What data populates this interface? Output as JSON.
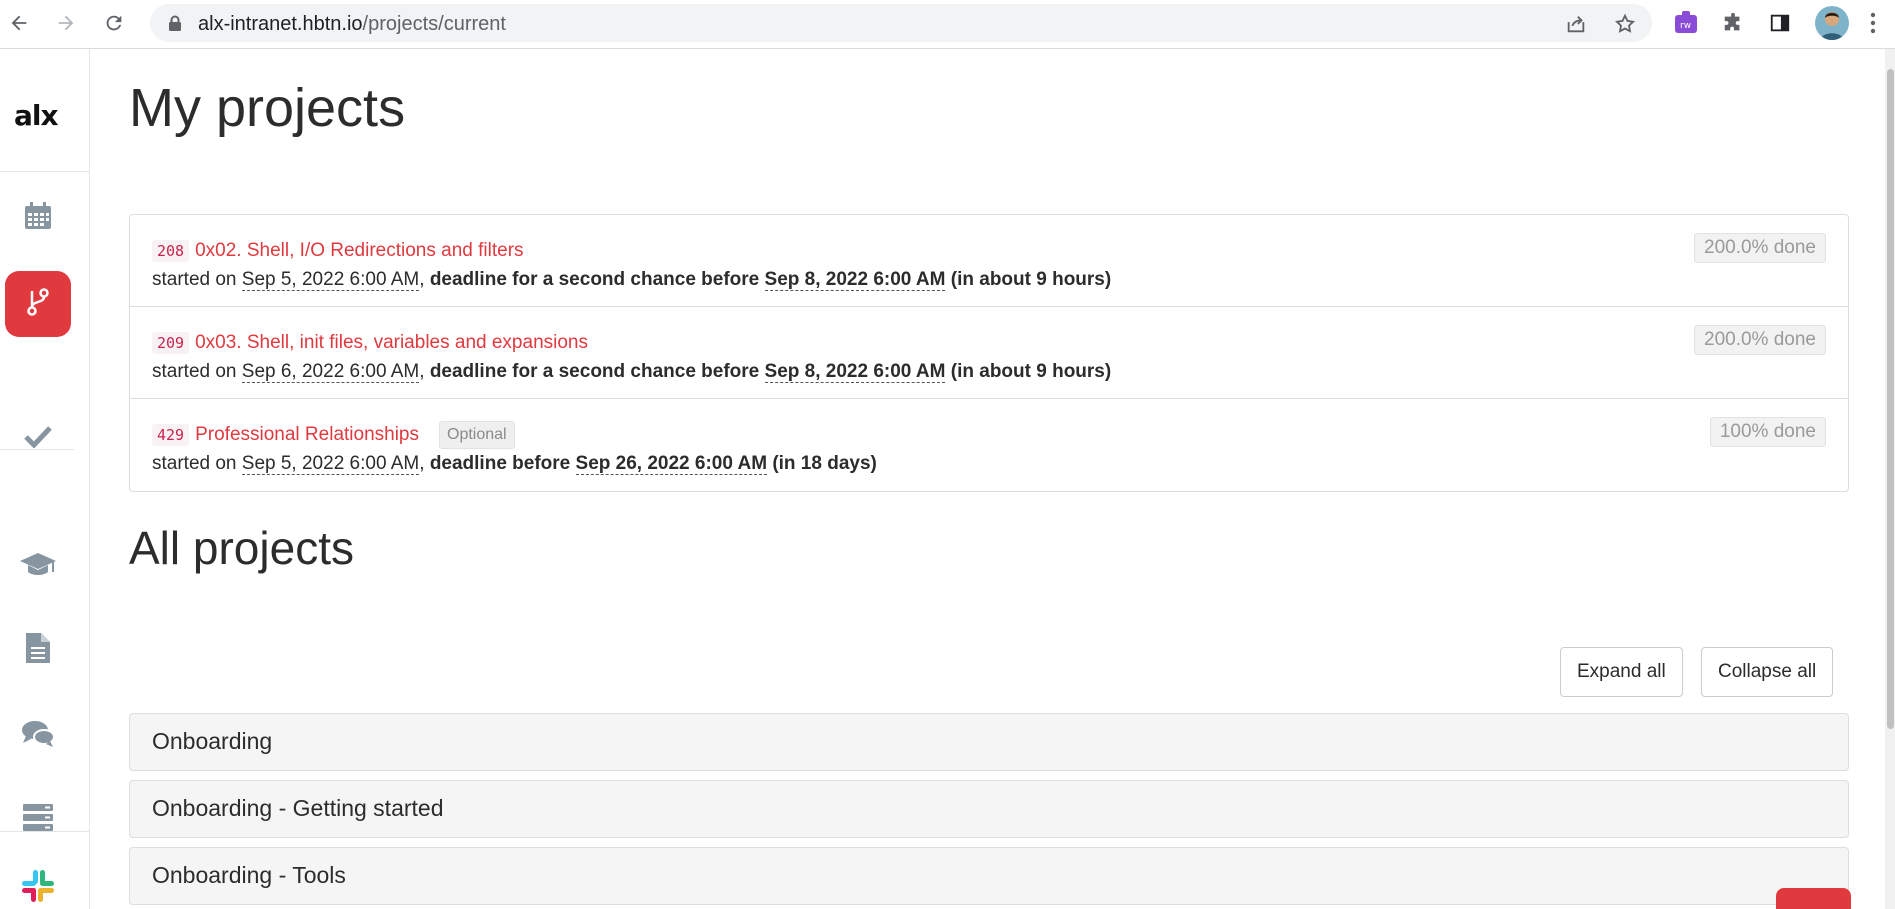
{
  "browser": {
    "url_host": "alx-intranet.hbtn.io",
    "url_path": "/projects/current",
    "extension_icons": [
      "back-arrow-icon",
      "forward-arrow-icon",
      "reload-icon",
      "lock-icon",
      "share-icon",
      "star-icon",
      "extension-rw-icon",
      "puzzle-icon",
      "side-panel-icon",
      "kebab-menu-icon"
    ]
  },
  "sidebar": {
    "logo": "alx",
    "items": [
      {
        "name": "calendar",
        "icon": "calendar-icon"
      },
      {
        "name": "projects",
        "icon": "branch-icon",
        "active": true
      },
      {
        "name": "checks",
        "icon": "check-icon"
      },
      {
        "name": "curriculum",
        "icon": "graduation-cap-icon"
      },
      {
        "name": "documents",
        "icon": "document-icon"
      },
      {
        "name": "discussions",
        "icon": "chat-bubbles-icon"
      },
      {
        "name": "servers",
        "icon": "server-icon"
      },
      {
        "name": "slack",
        "icon": "slack-icon"
      }
    ]
  },
  "main": {
    "title": "My projects",
    "current_projects": [
      {
        "number": "208",
        "name": "0x02. Shell, I/O Redirections and filters",
        "started_label": "started on",
        "started": "Sep 5, 2022 6:00 AM",
        "deadline_label": "deadline for a second chance before",
        "deadline": "Sep 8, 2022 6:00 AM",
        "relative": "(in about 9 hours)",
        "progress": "200.0% done",
        "optional": ""
      },
      {
        "number": "209",
        "name": "0x03. Shell, init files, variables and expansions",
        "started_label": "started on",
        "started": "Sep 6, 2022 6:00 AM",
        "deadline_label": "deadline for a second chance before",
        "deadline": "Sep 8, 2022 6:00 AM",
        "relative": "(in about 9 hours)",
        "progress": "200.0% done",
        "optional": ""
      },
      {
        "number": "429",
        "name": "Professional Relationships",
        "started_label": "started on",
        "started": "Sep 5, 2022 6:00 AM",
        "deadline_label": "deadline before",
        "deadline": "Sep 26, 2022 6:00 AM",
        "relative": "(in 18 days)",
        "progress": "100% done",
        "optional": "Optional"
      }
    ],
    "all_projects_title": "All projects",
    "expand_all_label": "Expand all",
    "collapse_all_label": "Collapse all",
    "sections": [
      "Onboarding",
      "Onboarding - Getting started",
      "Onboarding - Tools"
    ]
  },
  "colors": {
    "accent": "#e0393e",
    "code_bg": "#f9f2f4",
    "code_fg": "#c7254e"
  }
}
